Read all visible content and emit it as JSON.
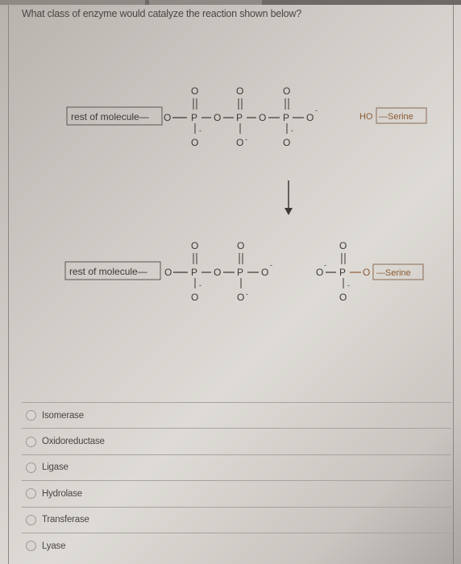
{
  "question": {
    "text": "What class of enzyme would catalyze the reaction shown below?"
  },
  "reaction": {
    "reactant": {
      "group_label": "rest of molecule—",
      "linking_oxygen": "O",
      "phosphate_atom": "P",
      "oxygen": "O",
      "charge": "-",
      "phosphate_count": 3
    },
    "acceptor": {
      "hydroxyl": "HO",
      "residue_label": "—Serine"
    },
    "arrow_icon": "down-arrow",
    "products": {
      "left": {
        "group_label": "rest of molecule—",
        "linking_oxygen": "O",
        "phosphate_atom": "P",
        "oxygen": "O",
        "charge": "-",
        "phosphate_count": 2
      },
      "right": {
        "phosphate_atom": "P",
        "oxygen": "O",
        "charge": "-",
        "residue_label": "—Serine"
      }
    },
    "colors": {
      "structure": "#3c3836",
      "serine_highlight": "#8a5a34"
    }
  },
  "answer_options": [
    {
      "label": "Isomerase",
      "selected": false
    },
    {
      "label": "Oxidoreductase",
      "selected": false
    },
    {
      "label": "Ligase",
      "selected": false
    },
    {
      "label": "Hydrolase",
      "selected": false
    },
    {
      "label": "Transferase",
      "selected": false
    },
    {
      "label": "Lyase",
      "selected": false
    }
  ]
}
